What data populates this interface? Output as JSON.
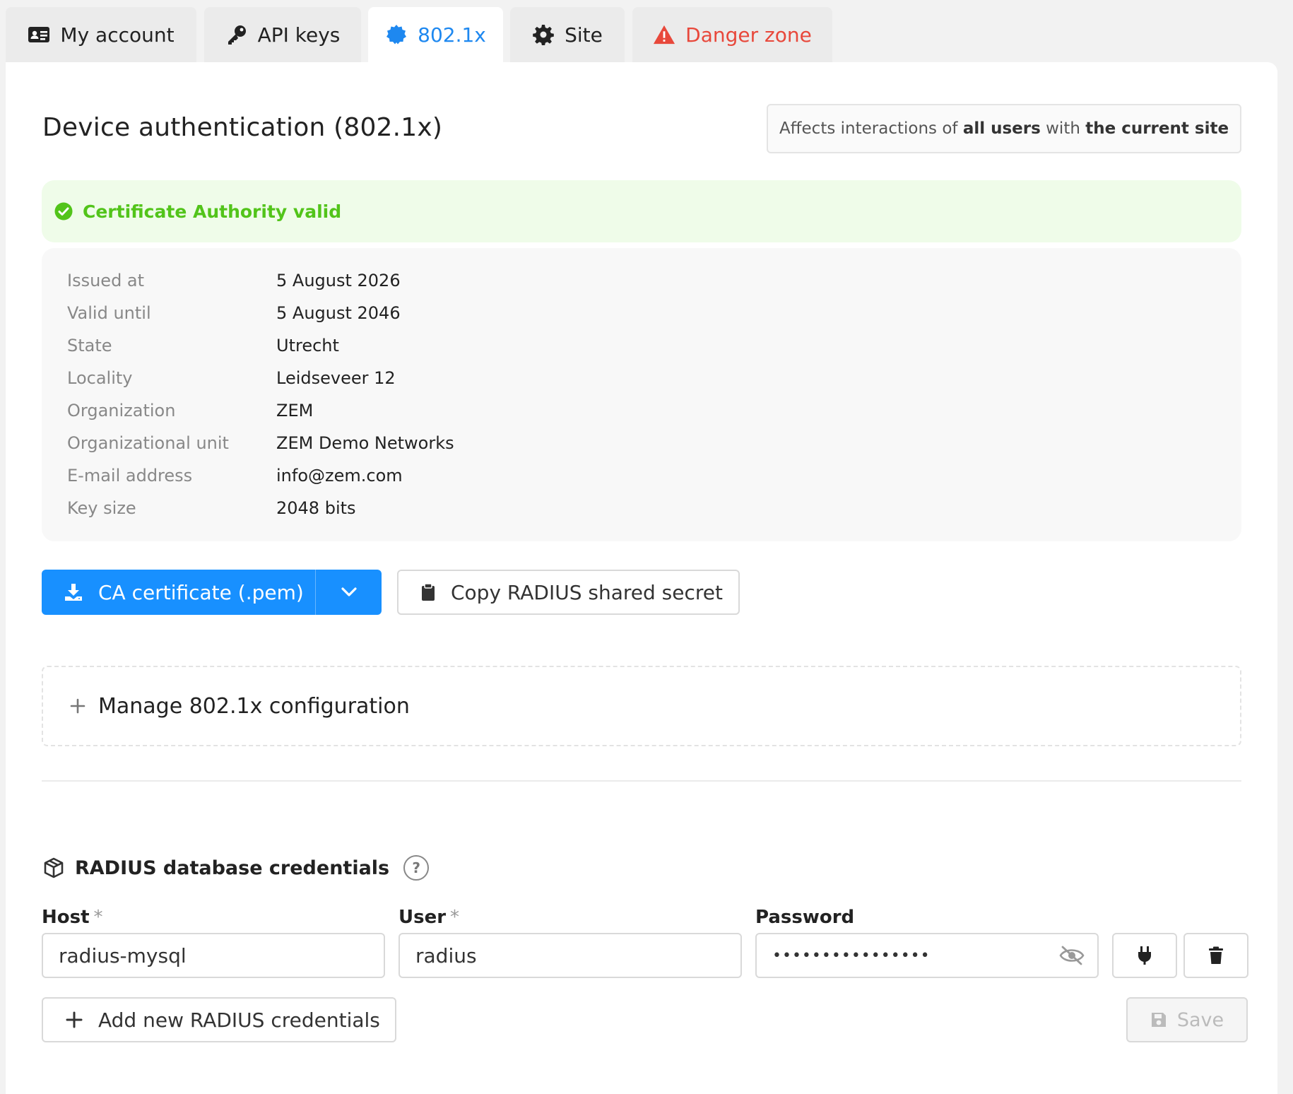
{
  "tabs": [
    {
      "label": "My account",
      "icon": "id-card-icon"
    },
    {
      "label": "API keys",
      "icon": "key-icon"
    },
    {
      "label": "802.1x",
      "icon": "badge-icon",
      "active": true
    },
    {
      "label": "Site",
      "icon": "gear-icon"
    },
    {
      "label": "Danger zone",
      "icon": "warning-icon"
    }
  ],
  "header": {
    "title": "Device authentication (802.1x)",
    "scope_prefix": "Affects interactions of",
    "scope_bold1": "all users",
    "scope_mid": "with",
    "scope_bold2": "the current site"
  },
  "status": {
    "text": "Certificate Authority valid",
    "color": "#52c41a"
  },
  "details": [
    {
      "label": "Issued at",
      "value": "5 August 2026"
    },
    {
      "label": "Valid until",
      "value": "5 August 2046"
    },
    {
      "label": "State",
      "value": "Utrecht"
    },
    {
      "label": "Locality",
      "value": "Leidseveer 12"
    },
    {
      "label": "Organization",
      "value": "ZEM"
    },
    {
      "label": "Organizational unit",
      "value": "ZEM Demo Networks"
    },
    {
      "label": "E-mail address",
      "value": "info@zem.com"
    },
    {
      "label": "Key size",
      "value": "2048 bits"
    }
  ],
  "actions": {
    "download_label": "CA certificate (.pem)",
    "copy_label": "Copy RADIUS shared secret"
  },
  "manage": {
    "label": "Manage 802.1x configuration"
  },
  "radius": {
    "title": "RADIUS database credentials",
    "help": "?",
    "host_label": "Host",
    "user_label": "User",
    "password_label": "Password",
    "required_mark": "*",
    "host_value": "radius-mysql",
    "user_value": "radius",
    "password_value": "••••••••••••••••",
    "add_label": "Add new RADIUS credentials",
    "save_label": "Save"
  },
  "colors": {
    "accent": "#1890ff",
    "danger": "#e8483b",
    "success": "#52c41a"
  }
}
